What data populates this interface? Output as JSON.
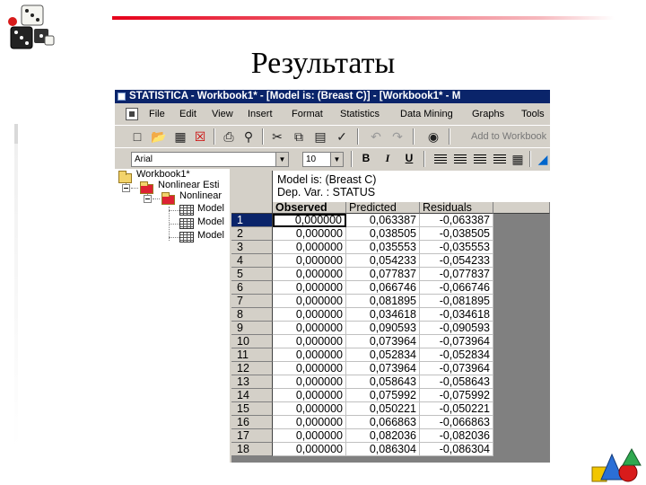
{
  "slide": {
    "title": "Результаты"
  },
  "window": {
    "title": "STATISTICA - Workbook1* - [Model is: (Breast C)] - [Workbook1* - M"
  },
  "menu": [
    "File",
    "Edit",
    "View",
    "Insert",
    "Format",
    "Statistics",
    "Data Mining",
    "Graphs",
    "Tools"
  ],
  "toolbar": {
    "add_to_workbook": "Add to Workbook",
    "font_name": "Arial",
    "font_size": "10",
    "bold_label": "B"
  },
  "tree": {
    "root": "Workbook1*",
    "level1": "Nonlinear Esti",
    "level2": "Nonlinear",
    "models": [
      "Model",
      "Model",
      "Model"
    ]
  },
  "sheet": {
    "header_line1": "Model is: (Breast C)",
    "header_line2": "Dep. Var. : STATUS",
    "columns": [
      "Observed",
      "Predicted",
      "Residuals"
    ],
    "rows": [
      {
        "n": "1",
        "observed": "0,000000",
        "predicted": "0,063387",
        "residual": "-0,063387"
      },
      {
        "n": "2",
        "observed": "0,000000",
        "predicted": "0,038505",
        "residual": "-0,038505"
      },
      {
        "n": "3",
        "observed": "0,000000",
        "predicted": "0,035553",
        "residual": "-0,035553"
      },
      {
        "n": "4",
        "observed": "0,000000",
        "predicted": "0,054233",
        "residual": "-0,054233"
      },
      {
        "n": "5",
        "observed": "0,000000",
        "predicted": "0,077837",
        "residual": "-0,077837"
      },
      {
        "n": "6",
        "observed": "0,000000",
        "predicted": "0,066746",
        "residual": "-0,066746"
      },
      {
        "n": "7",
        "observed": "0,000000",
        "predicted": "0,081895",
        "residual": "-0,081895"
      },
      {
        "n": "8",
        "observed": "0,000000",
        "predicted": "0,034618",
        "residual": "-0,034618"
      },
      {
        "n": "9",
        "observed": "0,000000",
        "predicted": "0,090593",
        "residual": "-0,090593"
      },
      {
        "n": "10",
        "observed": "0,000000",
        "predicted": "0,073964",
        "residual": "-0,073964"
      },
      {
        "n": "11",
        "observed": "0,000000",
        "predicted": "0,052834",
        "residual": "-0,052834"
      },
      {
        "n": "12",
        "observed": "0,000000",
        "predicted": "0,073964",
        "residual": "-0,073964"
      },
      {
        "n": "13",
        "observed": "0,000000",
        "predicted": "0,058643",
        "residual": "-0,058643"
      },
      {
        "n": "14",
        "observed": "0,000000",
        "predicted": "0,075992",
        "residual": "-0,075992"
      },
      {
        "n": "15",
        "observed": "0,000000",
        "predicted": "0,050221",
        "residual": "-0,050221"
      },
      {
        "n": "16",
        "observed": "0,000000",
        "predicted": "0,066863",
        "residual": "-0,066863"
      },
      {
        "n": "17",
        "observed": "0,000000",
        "predicted": "0,082036",
        "residual": "-0,082036"
      },
      {
        "n": "18",
        "observed": "0,000000",
        "predicted": "0,086304",
        "residual": "-0,086304"
      }
    ]
  },
  "colors": {
    "accent_line": "#e6001a",
    "titlebar": "#0a246a",
    "chrome": "#d4d0c8"
  }
}
